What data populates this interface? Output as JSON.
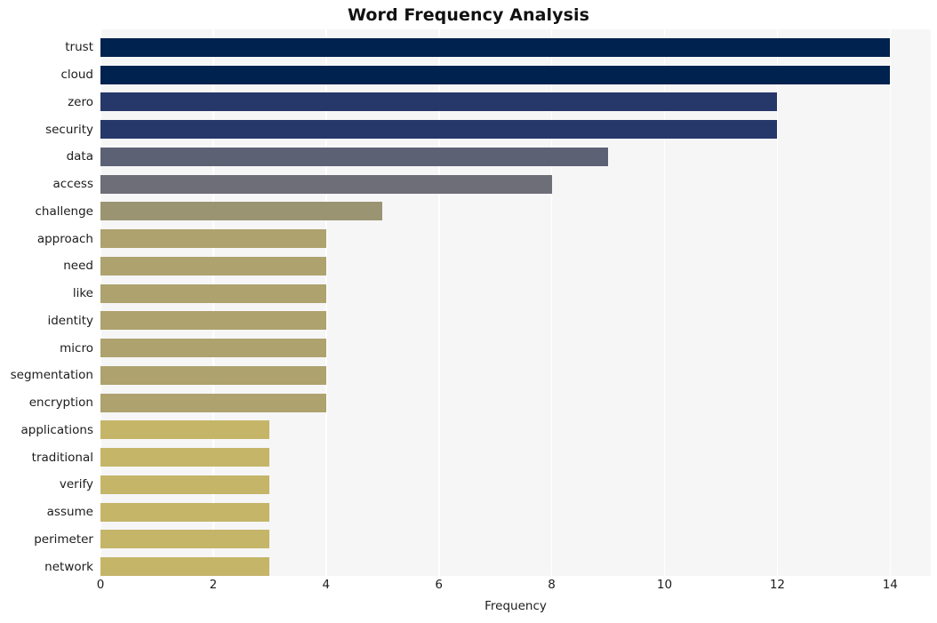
{
  "chart_data": {
    "type": "bar",
    "orientation": "horizontal",
    "title": "Word Frequency Analysis",
    "xlabel": "Frequency",
    "ylabel": "",
    "categories": [
      "trust",
      "cloud",
      "zero",
      "security",
      "data",
      "access",
      "challenge",
      "approach",
      "need",
      "like",
      "identity",
      "micro",
      "segmentation",
      "encryption",
      "applications",
      "traditional",
      "verify",
      "assume",
      "perimeter",
      "network"
    ],
    "values": [
      14,
      14,
      12,
      12,
      9,
      8,
      5,
      4,
      4,
      4,
      4,
      4,
      4,
      4,
      3,
      3,
      3,
      3,
      3,
      3
    ],
    "bar_colors": [
      "#00224e",
      "#00224e",
      "#26376a",
      "#26376a",
      "#5d6174",
      "#6d6e77",
      "#9b9473",
      "#aea26e",
      "#aea26e",
      "#aea26e",
      "#aea26e",
      "#aea26e",
      "#aea26e",
      "#aea26e",
      "#c4b569",
      "#c4b569",
      "#c4b569",
      "#c4b569",
      "#c4b569",
      "#c4b569"
    ],
    "xticks": [
      0,
      2,
      4,
      6,
      8,
      10,
      12,
      14
    ],
    "xtick_labels": [
      "0",
      "2",
      "4",
      "6",
      "8",
      "10",
      "12",
      "14"
    ],
    "xlim": [
      0,
      14.72
    ],
    "grid": true,
    "grid_axis": "x",
    "legend": "none",
    "plot_background": "#f6f6f7",
    "figure_background": "#ffffff",
    "gridline_color": "#ffffff",
    "text_color": "#1c1c1c"
  }
}
